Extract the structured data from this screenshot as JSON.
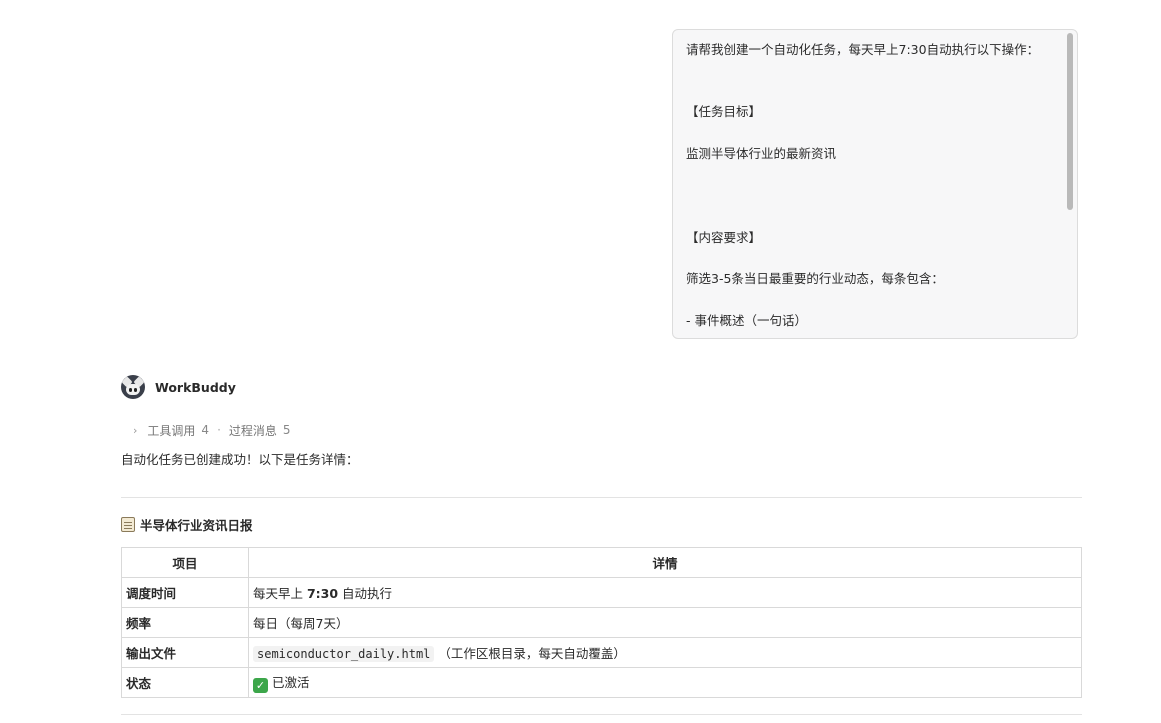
{
  "user_message": {
    "lines": [
      "请帮我创建一个自动化任务，每天早上7:30自动执行以下操作：",
      "【任务目标】",
      "监测半导体行业的最新资讯",
      "【内容要求】",
      "筛选3-5条当日最重要的行业动态，每条包含：",
      "- 事件概述（一句话）"
    ]
  },
  "assistant": {
    "name": "WorkBuddy",
    "process": {
      "tool_calls_label": "工具调用",
      "tool_calls_count": "4",
      "separator": "·",
      "process_msgs_label": "过程消息",
      "process_msgs_count": "5"
    },
    "intro": "自动化任务已创建成功！以下是任务详情：",
    "section_title": "半导体行业资讯日报",
    "table": {
      "headers": [
        "项目",
        "详情"
      ],
      "rows": [
        {
          "key": "调度时间",
          "value_prefix": "每天早上 ",
          "value_bold": "7:30",
          "value_suffix": " 自动执行"
        },
        {
          "key": "频率",
          "value": "每日（每周7天）"
        },
        {
          "key": "输出文件",
          "code": "semiconductor_daily.html",
          "value": "（工作区根目录，每天自动覆盖）"
        },
        {
          "key": "状态",
          "value": "已激活"
        }
      ]
    }
  }
}
